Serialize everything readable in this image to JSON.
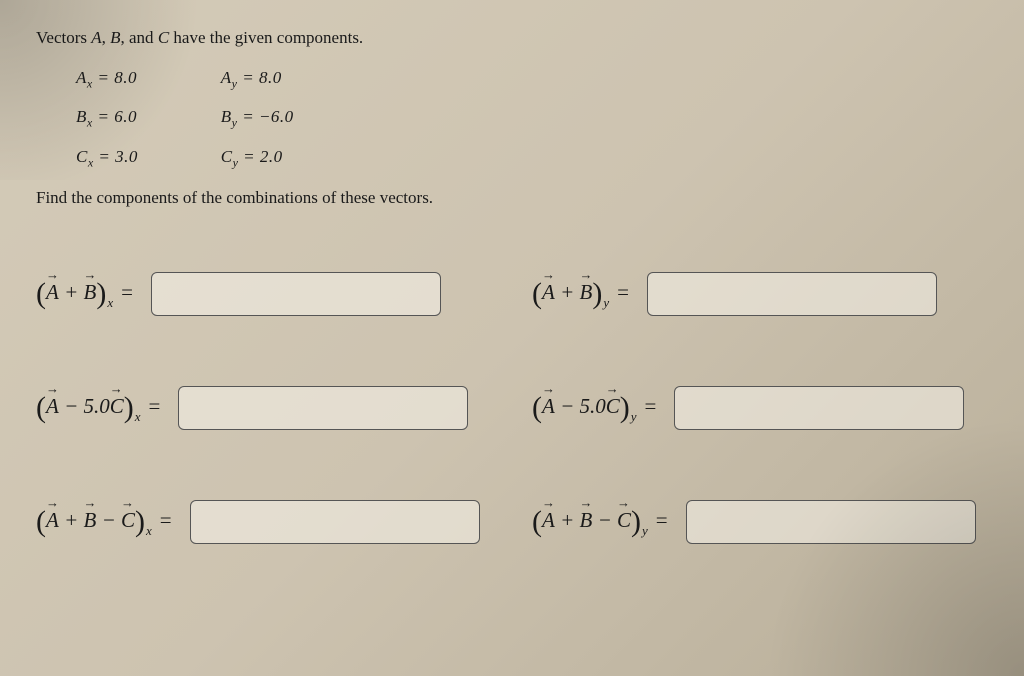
{
  "problem": {
    "intro": "Vectors A, B, and C have the given components.",
    "values": {
      "Ax": "Aₓ = 8.0",
      "Ay": "Aᵧ = 8.0",
      "Bx": "Bₓ = 6.0",
      "By": "Bᵧ = −6.0",
      "Cx": "Cₓ = 3.0",
      "Cy": "Cᵧ = 2.0"
    },
    "find": "Find the components of the combinations of these vectors."
  },
  "answers": [
    {
      "expr_html": "(A⃗ + B⃗)ₓ =",
      "component": "x",
      "terms": "A + B"
    },
    {
      "expr_html": "(A⃗ + B⃗)ᵧ =",
      "component": "y",
      "terms": "A + B"
    },
    {
      "expr_html": "(A⃗ − 5.0C⃗)ₓ =",
      "component": "x",
      "terms": "A − 5.0C"
    },
    {
      "expr_html": "(A⃗ − 5.0C⃗)ᵧ =",
      "component": "y",
      "terms": "A − 5.0C"
    },
    {
      "expr_html": "(A⃗ + B⃗ − C⃗)ₓ =",
      "component": "x",
      "terms": "A + B − C"
    },
    {
      "expr_html": "(A⃗ + B⃗ − C⃗)ᵧ =",
      "component": "y",
      "terms": "A + B − C"
    }
  ]
}
